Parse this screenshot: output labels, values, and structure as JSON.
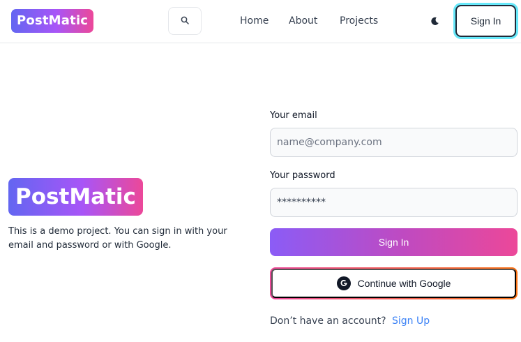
{
  "navbar": {
    "brand": "PostMatic",
    "search_icon": "search-icon",
    "links": [
      "Home",
      "About",
      "Projects"
    ],
    "theme_icon": "moon-icon",
    "sign_in_label": "Sign In"
  },
  "hero": {
    "brand": "PostMatic",
    "description": "This is a demo project. You can sign in with your email and password or with Google."
  },
  "form": {
    "email_label": "Your email",
    "email_placeholder": "name@company.com",
    "password_label": "Your password",
    "password_value": "**********",
    "submit_label": "Sign In",
    "google_label": "Continue with Google",
    "google_icon": "google-icon",
    "footer_text": "Don’t have an account?",
    "signup_label": "Sign Up"
  },
  "colors": {
    "gradient_start": "#6366f1",
    "gradient_end": "#ec4899",
    "link": "#3b82f6",
    "focus_ring": "#67e8f9"
  }
}
